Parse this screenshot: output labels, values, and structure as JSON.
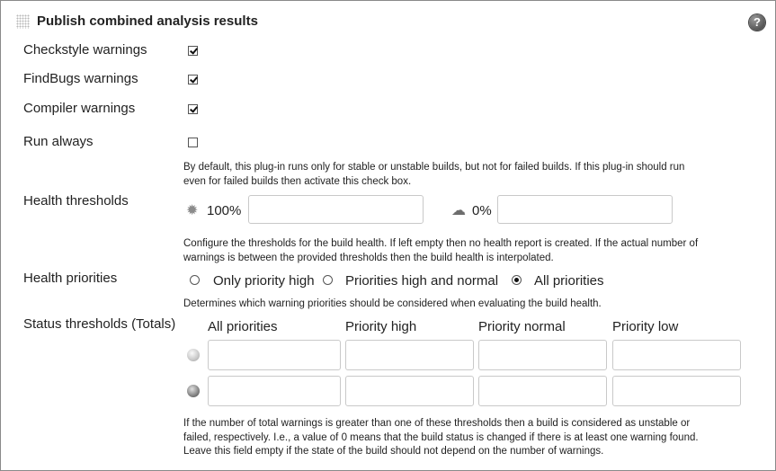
{
  "section": {
    "title": "Publish combined analysis results",
    "help_icon": "question-mark",
    "help_glyph": "?"
  },
  "options": {
    "checkstyle": {
      "label": "Checkstyle warnings",
      "checked": true
    },
    "findbugs": {
      "label": "FindBugs warnings",
      "checked": true
    },
    "compiler": {
      "label": "Compiler warnings",
      "checked": true
    },
    "run_always": {
      "label": "Run always",
      "checked": false,
      "description_line1": "By default, this plug-in runs only for stable or unstable builds, but not for failed builds. If this plug-in should run",
      "description_line2": "even for failed builds then activate this check box."
    }
  },
  "health_thresholds": {
    "label": "Health thresholds",
    "sunny_icon": "sun-icon",
    "sunny_value": "100%",
    "sunny_input": "",
    "stormy_icon": "storm-cloud-icon",
    "stormy_value": "0%",
    "stormy_input": "",
    "description_line1": "Configure the thresholds for the build health. If left empty then no health report is created. If the actual number of",
    "description_line2": "warnings is between the provided thresholds then the build health is interpolated."
  },
  "health_priorities": {
    "label": "Health priorities",
    "options": [
      {
        "label": "Only priority high",
        "selected": false
      },
      {
        "label": "Priorities high and normal",
        "selected": false
      },
      {
        "label": "All priorities",
        "selected": true
      }
    ],
    "description": "Determines which warning priorities should be considered when evaluating the build health."
  },
  "status_thresholds": {
    "label": "Status thresholds (Totals)",
    "columns": [
      "All priorities",
      "Priority high",
      "Priority normal",
      "Priority low"
    ],
    "rows": [
      {
        "icon": "yellow-ball-icon",
        "values": [
          "",
          "",
          "",
          ""
        ]
      },
      {
        "icon": "red-ball-icon",
        "values": [
          "",
          "",
          "",
          ""
        ]
      }
    ],
    "description_line1": "If the number of total warnings is greater than one of these thresholds then a build is considered as unstable or",
    "description_line2": "failed, respectively. I.e., a value of 0 means that the build status is changed if there is at least one warning found.",
    "description_line3": "Leave this field empty if the state of the build should not depend on the number of warnings."
  }
}
